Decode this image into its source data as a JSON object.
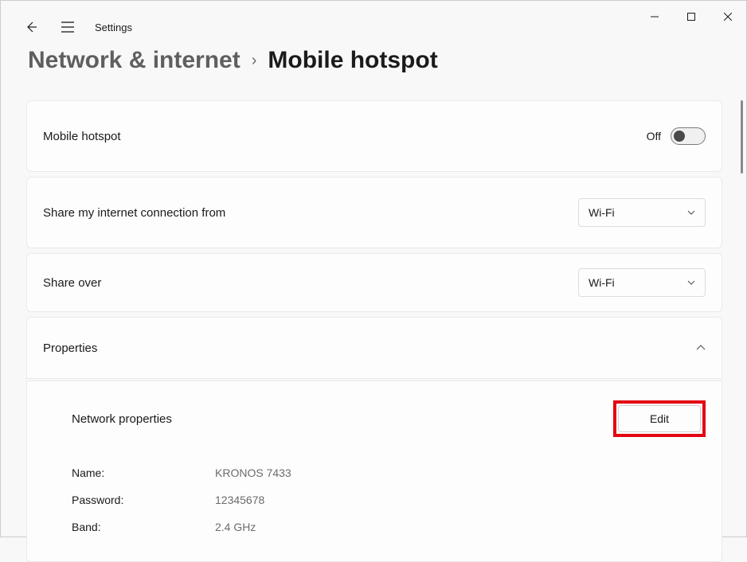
{
  "window": {
    "app_title": "Settings"
  },
  "breadcrumb": {
    "parent": "Network & internet",
    "separator": "›",
    "current": "Mobile hotspot"
  },
  "cards": {
    "hotspot": {
      "label": "Mobile hotspot",
      "state_text": "Off",
      "on": false
    },
    "share_from": {
      "label": "Share my internet connection from",
      "selected": "Wi-Fi"
    },
    "share_over": {
      "label": "Share over",
      "selected": "Wi-Fi"
    },
    "properties": {
      "label": "Properties",
      "expanded": true,
      "network_properties_label": "Network properties",
      "edit_label": "Edit",
      "fields": {
        "name_label": "Name:",
        "name_value": "KRONOS 7433",
        "password_label": "Password:",
        "password_value": "12345678",
        "band_label": "Band:",
        "band_value": "2.4 GHz"
      }
    }
  }
}
